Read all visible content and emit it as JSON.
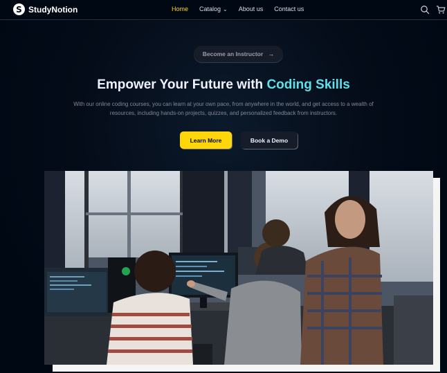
{
  "navbar": {
    "logo_text": "StudyNotion",
    "logo_icon": "studynotion-logo-icon",
    "links": [
      {
        "label": "Home",
        "active": true
      },
      {
        "label": "Catalog",
        "active": false,
        "dropdown": true
      },
      {
        "label": "About us",
        "active": false
      },
      {
        "label": "Contact us",
        "active": false
      }
    ],
    "icons": [
      "search-icon",
      "cart-icon"
    ]
  },
  "hero": {
    "instructor_button": "Become an Instructor",
    "headline_prefix": "Empower Your Future with ",
    "headline_highlight": "Coding Skills",
    "subtext": "With our online coding courses, you can learn at your own pace, from anywhere in the world, and get access to a wealth of resources, including hands-on projects, quizzes, and personalized feedback from instructors.",
    "primary_button": "Learn More",
    "secondary_button": "Book a Demo",
    "media": "hero-video"
  },
  "colors": {
    "background": "#000814",
    "accent_yellow": "#FFD60A",
    "highlight_cyan": "#5fe0ea",
    "button_dark": "#161D29"
  }
}
